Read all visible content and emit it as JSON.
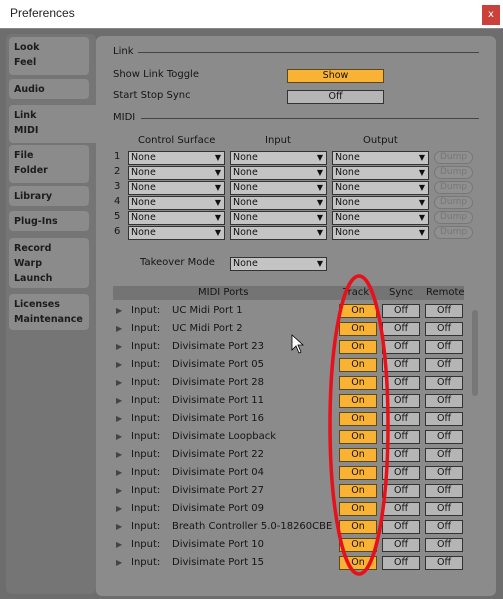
{
  "window": {
    "title": "Preferences",
    "close_label": "x"
  },
  "sidebar": {
    "tabs": [
      {
        "label": "Look\nFeel"
      },
      {
        "label": "Audio"
      },
      {
        "label": "Link\nMIDI",
        "active": true
      },
      {
        "label": "File\nFolder"
      },
      {
        "label": "Library"
      },
      {
        "label": "Plug-Ins"
      },
      {
        "label": "Record\nWarp\nLaunch"
      },
      {
        "label": "Licenses\nMaintenance"
      }
    ]
  },
  "link": {
    "section": "Link",
    "show_toggle_label": "Show Link Toggle",
    "show_toggle_value": "Show",
    "sync_label": "Start Stop Sync",
    "sync_value": "Off"
  },
  "midi": {
    "section": "MIDI",
    "col_control": "Control Surface",
    "col_input": "Input",
    "col_output": "Output",
    "rows": [
      {
        "n": "1",
        "cs": "None",
        "in": "None",
        "out": "None",
        "dump": "Dump"
      },
      {
        "n": "2",
        "cs": "None",
        "in": "None",
        "out": "None",
        "dump": "Dump"
      },
      {
        "n": "3",
        "cs": "None",
        "in": "None",
        "out": "None",
        "dump": "Dump"
      },
      {
        "n": "4",
        "cs": "None",
        "in": "None",
        "out": "None",
        "dump": "Dump"
      },
      {
        "n": "5",
        "cs": "None",
        "in": "None",
        "out": "None",
        "dump": "Dump"
      },
      {
        "n": "6",
        "cs": "None",
        "in": "None",
        "out": "None",
        "dump": "Dump"
      }
    ],
    "takeover_label": "Takeover Mode",
    "takeover_value": "None"
  },
  "ports": {
    "header": "MIDI Ports",
    "col_track": "Track",
    "col_sync": "Sync",
    "col_remote": "Remote",
    "rows": [
      {
        "dir": "Input:",
        "name": "UC Midi Port 1",
        "track": "On",
        "sync": "Off",
        "remote": "Off"
      },
      {
        "dir": "Input:",
        "name": "UC Midi Port 2",
        "track": "On",
        "sync": "Off",
        "remote": "Off"
      },
      {
        "dir": "Input:",
        "name": "Divisimate Port 23",
        "track": "On",
        "sync": "Off",
        "remote": "Off"
      },
      {
        "dir": "Input:",
        "name": "Divisimate Port 05",
        "track": "On",
        "sync": "Off",
        "remote": "Off"
      },
      {
        "dir": "Input:",
        "name": "Divisimate Port 28",
        "track": "On",
        "sync": "Off",
        "remote": "Off"
      },
      {
        "dir": "Input:",
        "name": "Divisimate Port 11",
        "track": "On",
        "sync": "Off",
        "remote": "Off"
      },
      {
        "dir": "Input:",
        "name": "Divisimate Port 16",
        "track": "On",
        "sync": "Off",
        "remote": "Off"
      },
      {
        "dir": "Input:",
        "name": "Divisimate Loopback",
        "track": "On",
        "sync": "Off",
        "remote": "Off"
      },
      {
        "dir": "Input:",
        "name": "Divisimate Port 22",
        "track": "On",
        "sync": "Off",
        "remote": "Off"
      },
      {
        "dir": "Input:",
        "name": "Divisimate Port 04",
        "track": "On",
        "sync": "Off",
        "remote": "Off"
      },
      {
        "dir": "Input:",
        "name": "Divisimate Port 27",
        "track": "On",
        "sync": "Off",
        "remote": "Off"
      },
      {
        "dir": "Input:",
        "name": "Divisimate Port 09",
        "track": "On",
        "sync": "Off",
        "remote": "Off"
      },
      {
        "dir": "Input:",
        "name": "Breath Controller 5.0-18260CBE",
        "track": "On",
        "sync": "Off",
        "remote": "Off"
      },
      {
        "dir": "Input:",
        "name": "Divisimate Port 10",
        "track": "On",
        "sync": "Off",
        "remote": "Off"
      },
      {
        "dir": "Input:",
        "name": "Divisimate Port 15",
        "track": "On",
        "sync": "Off",
        "remote": "Off"
      }
    ]
  },
  "colors": {
    "accent": "#f9b233",
    "annotation": "#e8101a",
    "close": "#c9413a"
  }
}
